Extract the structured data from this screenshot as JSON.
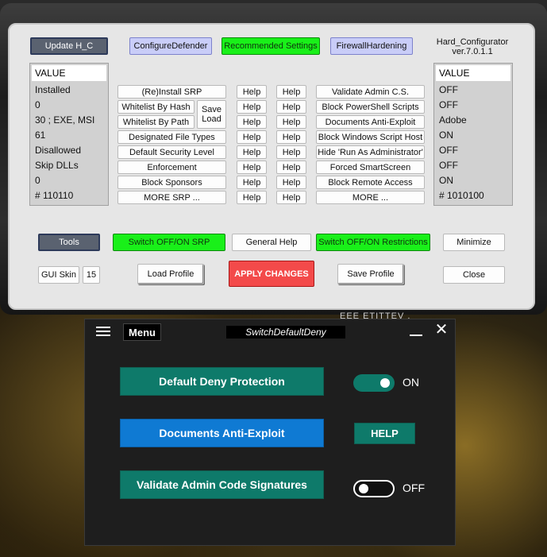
{
  "hc": {
    "title_line1": "Hard_Configurator",
    "title_line2": "ver.7.0.1.1",
    "top_buttons": {
      "update": "Update H_C",
      "configure_defender": "ConfigureDefender",
      "recommended": "Recommended Settings",
      "firewall": "FirewallHardening"
    },
    "left_values": {
      "header": "VALUE",
      "rows": [
        "Installed",
        "0",
        "30 ;  EXE, MSI",
        "61",
        "Disallowed",
        "Skip DLLs",
        "0",
        "# 110110"
      ]
    },
    "right_values": {
      "header": "VALUE",
      "rows": [
        "OFF",
        "OFF",
        "Adobe",
        "ON",
        "OFF",
        "OFF",
        "ON",
        "# 1010100"
      ]
    },
    "srp_buttons": [
      "(Re)Install SRP",
      "Whitelist By Hash",
      "Whitelist By Path",
      "Designated File Types",
      "Default Security Level",
      "Enforcement",
      "Block Sponsors",
      "MORE SRP ..."
    ],
    "save_load": {
      "save": "Save",
      "load": "Load"
    },
    "help_label": "Help",
    "restriction_buttons": [
      "Validate Admin C.S.",
      "Block PowerShell Scripts",
      "Documents Anti-Exploit",
      "Block Windows Script Host",
      "Hide  'Run As Administrator'",
      "Forced SmartScreen",
      "Block Remote Access",
      "MORE ..."
    ],
    "bottom": {
      "tools": "Tools",
      "switch_srp": "Switch OFF/ON SRP",
      "general_help": "General Help",
      "switch_restrictions": "Switch OFF/ON Restrictions",
      "minimize": "Minimize",
      "gui_skin": "GUI Skin",
      "gui_skin_value": "15",
      "load_profile": "Load Profile",
      "apply": "APPLY CHANGES",
      "save_profile": "Save Profile",
      "close": "Close"
    },
    "background_text": "EEE ETITTEV ."
  },
  "sd": {
    "menu": "Menu",
    "title": "SwitchDefaultDeny",
    "default_deny": "Default Deny Protection",
    "default_deny_state": "ON",
    "docs_anti_exploit": "Documents Anti-Exploit",
    "help": "HELP",
    "validate_admin": "Validate Admin Code Signatures",
    "validate_admin_state": "OFF"
  },
  "colors": {
    "teal": "#0e7a6a",
    "blue": "#0f7ad3",
    "green": "#19f019",
    "red": "#f34a4a",
    "purple": "#c9cdf8"
  }
}
